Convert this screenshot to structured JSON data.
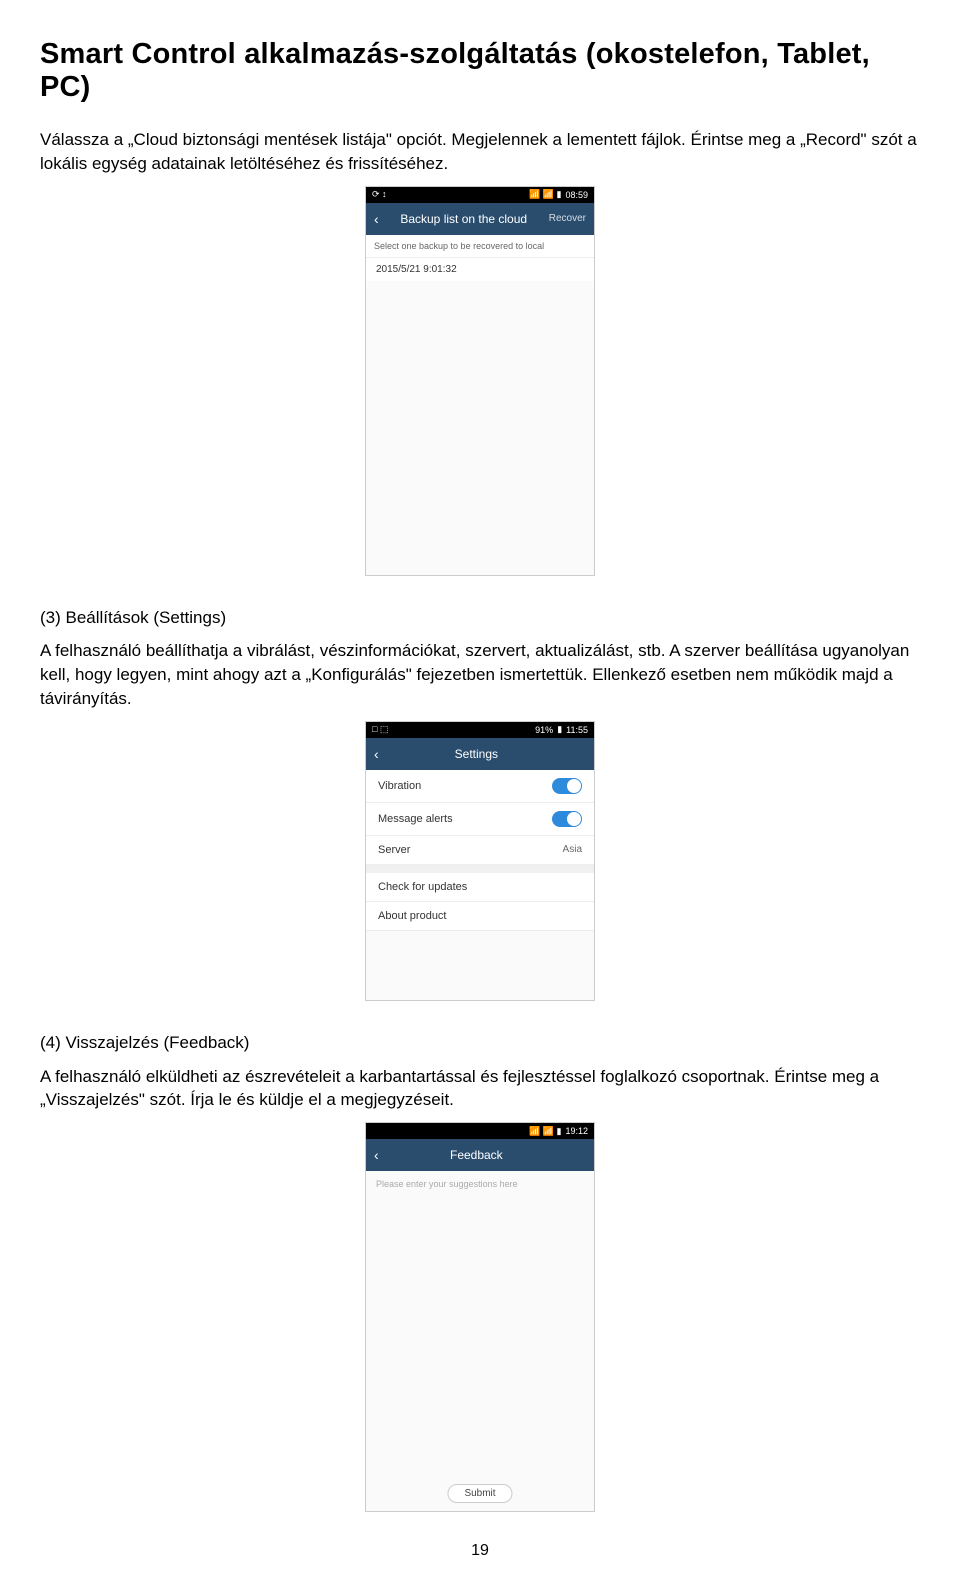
{
  "title": "Smart Control alkalmazás-szolgáltatás (okostelefon, Tablet, PC)",
  "para1": "Válassza a „Cloud biztonsági mentések listája\" opciót. Megjelennek a lementett fájlok. Érintse meg a „Record\" szót a lokális egység adatainak letöltéséhez és frissítéséhez.",
  "phone1": {
    "time": "08:59",
    "appbar_title": "Backup list on the cloud",
    "appbar_right": "Recover",
    "hint": "Select one backup to be recovered to local",
    "record": "2015/5/21 9:01:32"
  },
  "para2_heading": "(3) Beállítások (Settings)",
  "para2": "A felhasználó beállíthatja a vibrálást, vészinformációkat, szervert, aktualizálást, stb. A szerver beállítása ugyanolyan kell, hogy legyen, mint ahogy azt a „Konfigurálás\" fejezetben ismertettük. Ellenkező esetben nem működik majd a távirányítás.",
  "phone2": {
    "time": "11:55",
    "signal": "91%",
    "appbar_title": "Settings",
    "rows": {
      "vibration": "Vibration",
      "message_alerts": "Message alerts",
      "server": "Server",
      "server_val": "Asia",
      "check_updates": "Check for updates",
      "about": "About product"
    }
  },
  "para3_heading": "(4) Visszajelzés (Feedback)",
  "para3": "A felhasználó elküldheti az észrevételeit a karbantartással és fejlesztéssel foglalkozó csoportnak. Érintse meg a „Visszajelzés\" szót. Írja le és küldje el a megjegyzéseit.",
  "phone3": {
    "time": "19:12",
    "appbar_title": "Feedback",
    "placeholder": "Please enter your suggestions here",
    "submit": "Submit"
  },
  "page_number": "19"
}
